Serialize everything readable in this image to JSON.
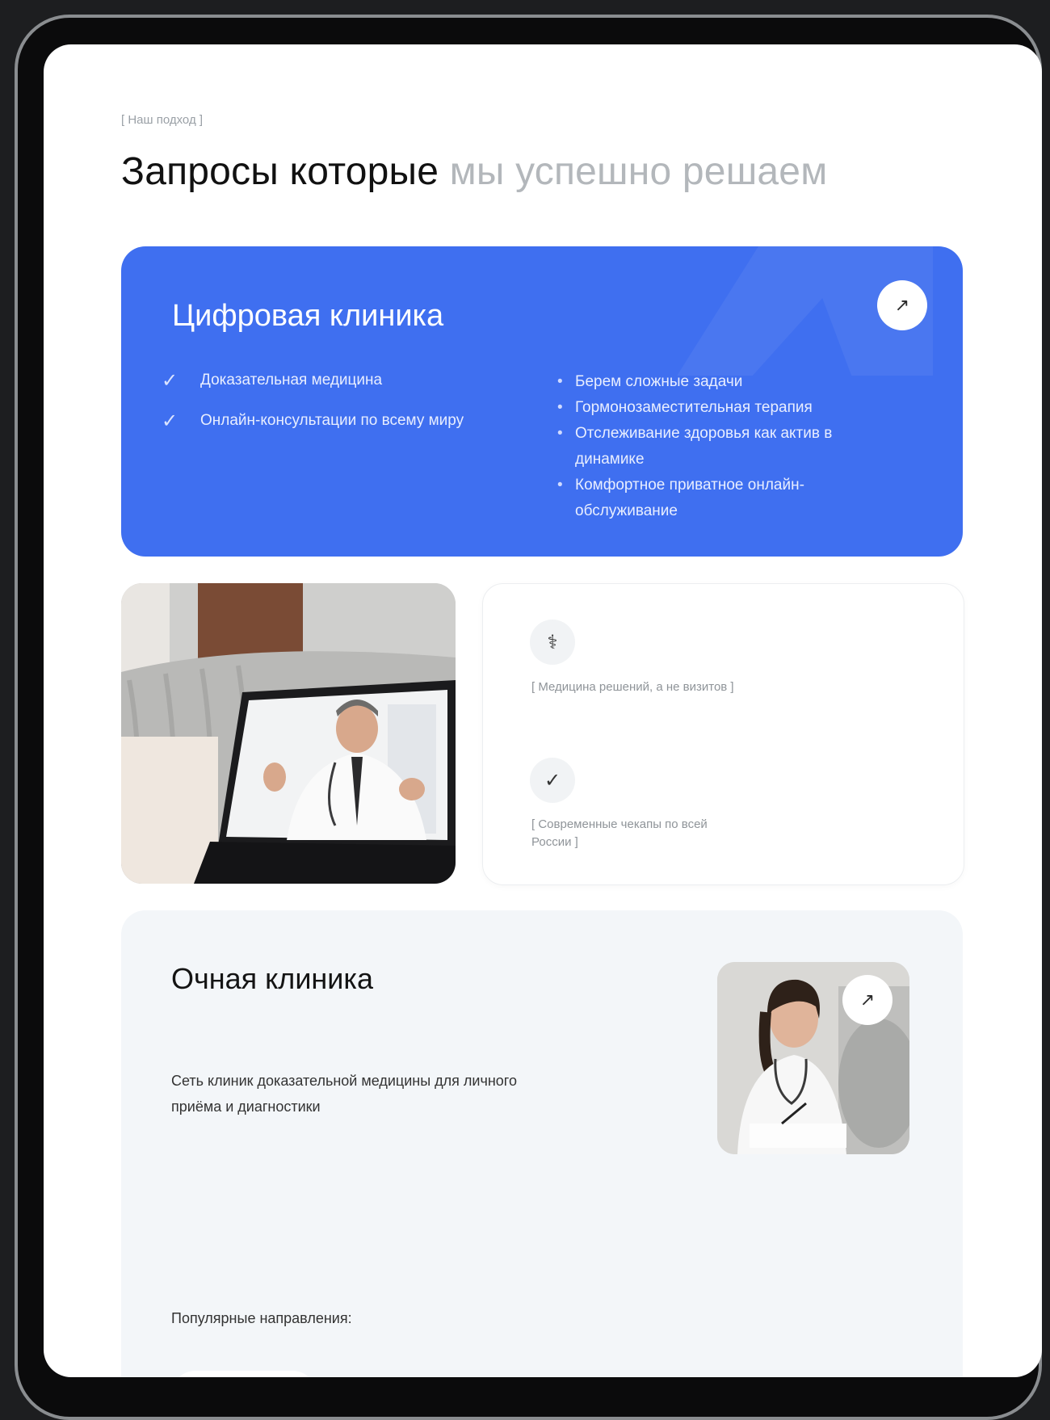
{
  "eyebrow": "[ Наш подход ]",
  "heading": {
    "dark": "Запросы которые",
    "muted": "мы успешно решаем"
  },
  "digital_clinic": {
    "title": "Цифровая клиника",
    "arrow": "↗",
    "checks": [
      "Доказательная медицина",
      "Онлайн-консультации по всему миру"
    ],
    "bullets": [
      "Берем сложные задачи",
      "Гормонозаместительная терапия",
      "Отслеживание здоровья как актив в динамике",
      "Комфортное приватное онлайн-обслуживание"
    ]
  },
  "features": [
    {
      "icon": "stethoscope-icon",
      "glyph": "⚕",
      "text": "[ Медицина решений, а не визитов ]"
    },
    {
      "icon": "check-circle-icon",
      "glyph": "✓",
      "text": "[ Современные чекапы по всей России ]"
    }
  ],
  "offline_clinic": {
    "title": "Очная клиника",
    "description": "Сеть клиник доказательной медицины для личного приёма и диагностики",
    "arrow": "↗",
    "popular_label": "Популярные направления:"
  },
  "colors": {
    "accent_blue": "#3f6ff0",
    "light_gray_bg": "#f3f6f9"
  }
}
